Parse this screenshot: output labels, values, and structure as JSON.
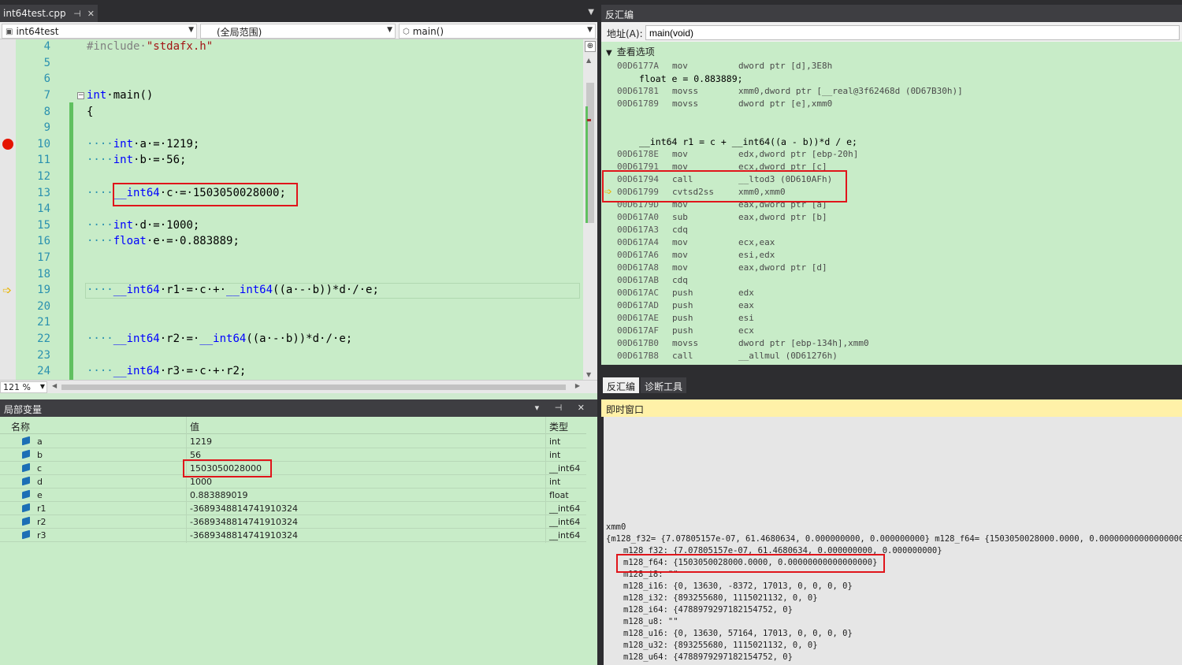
{
  "editor": {
    "tab_label": "int64test.cpp",
    "tab_pin": "⊣",
    "tab_close": "✕",
    "nav_project": "int64test",
    "nav_scope": "(全局范围)",
    "nav_function": "main()",
    "zoom": "121 %",
    "line_numbers": [
      "4",
      "5",
      "6",
      "7",
      "8",
      "9",
      "10",
      "11",
      "12",
      "13",
      "14",
      "15",
      "16",
      "17",
      "18",
      "19",
      "20",
      "21",
      "22",
      "23",
      "24"
    ],
    "code": {
      "l4_pp": "#include·",
      "l4_str": "\"stdafx.h\"",
      "l7_kw": "int",
      "l7_rest": "·main()",
      "l8": "{",
      "l10_ws": "····",
      "l10_kw": "int",
      "l10_rest": "·a·=·1219;",
      "l11_ws": "····",
      "l11_kw": "int",
      "l11_rest": "·b·=·56;",
      "l13_ws": "····",
      "l13_kw": "__int64",
      "l13_rest": "·c·=·1503050028000;",
      "l15_ws": "····",
      "l15_kw": "int",
      "l15_rest": "·d·=·1000;",
      "l16_ws": "····",
      "l16_kw": "float",
      "l16_rest": "·e·=·0.883889;",
      "l19_ws": "····",
      "l19_kw": "__int64",
      "l19_mid": "·r1·=·c·+·",
      "l19_kw2": "__int64",
      "l19_rest": "((a·-·b))*d·/·e;",
      "l22_ws": "····",
      "l22_kw": "__int64",
      "l22_mid": "·r2·=·",
      "l22_kw2": "__int64",
      "l22_rest": "((a·-·b))*d·/·e;",
      "l24_ws": "····",
      "l24_kw": "__int64",
      "l24_rest": "·r3·=·c·+·r2;"
    }
  },
  "disasm": {
    "title": "反汇编",
    "addr_label": "地址(A):",
    "addr_value": "main(void)",
    "view_options": "查看选项",
    "src_float": "float e = 0.883889;",
    "src_r1": "__int64 r1 = c + __int64((a - b))*d / e;",
    "rows": [
      {
        "addr": "00D6177A",
        "mn": "mov",
        "op": "dword ptr [d],3E8h"
      },
      {
        "addr": "00D61781",
        "mn": "movss",
        "op": "xmm0,dword ptr [__real@3f62468d (0D67B30h)]"
      },
      {
        "addr": "00D61789",
        "mn": "movss",
        "op": "dword ptr [e],xmm0"
      },
      {
        "addr": "00D6178E",
        "mn": "mov",
        "op": "edx,dword ptr [ebp-20h]"
      },
      {
        "addr": "00D61791",
        "mn": "mov",
        "op": "ecx,dword ptr [c]"
      },
      {
        "addr": "00D61794",
        "mn": "call",
        "op": "__ltod3 (0D610AFh)"
      },
      {
        "addr": "00D61799",
        "mn": "cvtsd2ss",
        "op": "xmm0,xmm0"
      },
      {
        "addr": "00D6179D",
        "mn": "mov",
        "op": "eax,dword ptr [a]"
      },
      {
        "addr": "00D617A0",
        "mn": "sub",
        "op": "eax,dword ptr [b]"
      },
      {
        "addr": "00D617A3",
        "mn": "cdq",
        "op": ""
      },
      {
        "addr": "00D617A4",
        "mn": "mov",
        "op": "ecx,eax"
      },
      {
        "addr": "00D617A6",
        "mn": "mov",
        "op": "esi,edx"
      },
      {
        "addr": "00D617A8",
        "mn": "mov",
        "op": "eax,dword ptr [d]"
      },
      {
        "addr": "00D617AB",
        "mn": "cdq",
        "op": ""
      },
      {
        "addr": "00D617AC",
        "mn": "push",
        "op": "edx"
      },
      {
        "addr": "00D617AD",
        "mn": "push",
        "op": "eax"
      },
      {
        "addr": "00D617AE",
        "mn": "push",
        "op": "esi"
      },
      {
        "addr": "00D617AF",
        "mn": "push",
        "op": "ecx"
      },
      {
        "addr": "00D617B0",
        "mn": "movss",
        "op": "dword ptr [ebp-134h],xmm0"
      },
      {
        "addr": "00D617B8",
        "mn": "call",
        "op": "__allmul (0D61276h)"
      }
    ],
    "tab_disasm": "反汇编",
    "tab_diag": "诊断工具"
  },
  "locals": {
    "title": "局部变量",
    "controls": "▾ ⊣ ✕",
    "col_name": "名称",
    "col_value": "值",
    "col_type": "类型",
    "rows": [
      {
        "name": "a",
        "value": "1219",
        "type": "int"
      },
      {
        "name": "b",
        "value": "56",
        "type": "int"
      },
      {
        "name": "c",
        "value": "1503050028000",
        "type": "__int64"
      },
      {
        "name": "d",
        "value": "1000",
        "type": "int"
      },
      {
        "name": "e",
        "value": "0.883889019",
        "type": "float"
      },
      {
        "name": "r1",
        "value": "-3689348814741910324",
        "type": "__int64"
      },
      {
        "name": "r2",
        "value": "-3689348814741910324",
        "type": "__int64"
      },
      {
        "name": "r3",
        "value": "-3689348814741910324",
        "type": "__int64"
      }
    ]
  },
  "immediate": {
    "title": "即时窗口",
    "lines": [
      "xmm0",
      "{m128_f32= {7.07805157e-07, 61.4680634, 0.000000000, 0.000000000} m128_f64= {1503050028000.0000, 0.00000000000000000} ...}",
      "m128_f32: {7.07805157e-07, 61.4680634, 0.000000000, 0.000000000}",
      "m128_f64: {1503050028000.0000, 0.00000000000000000}",
      "m128_i8: \"\"",
      "m128_i16: {0, 13630, -8372, 17013, 0, 0, 0, 0}",
      "m128_i32: {893255680, 1115021132, 0, 0}",
      "m128_i64: {4788979297182154752, 0}",
      "m128_u8: \"\"",
      "m128_u16: {0, 13630, 57164, 17013, 0, 0, 0, 0}",
      "m128_u32: {893255680, 1115021132, 0, 0}",
      "m128_u64: {4788979297182154752, 0}"
    ]
  },
  "colors": {
    "breakpoint": "#e51400",
    "highlight_box": "#e0151b",
    "exec_arrow": "#e8b400",
    "keyword": "#0000ff",
    "string": "#a31515",
    "line_number": "#2b91af"
  },
  "icons": [
    "pin-icon",
    "close-icon",
    "breakpoint-icon",
    "execution-arrow-icon",
    "collapse-icon",
    "variable-icon",
    "chevron-down-icon"
  ]
}
